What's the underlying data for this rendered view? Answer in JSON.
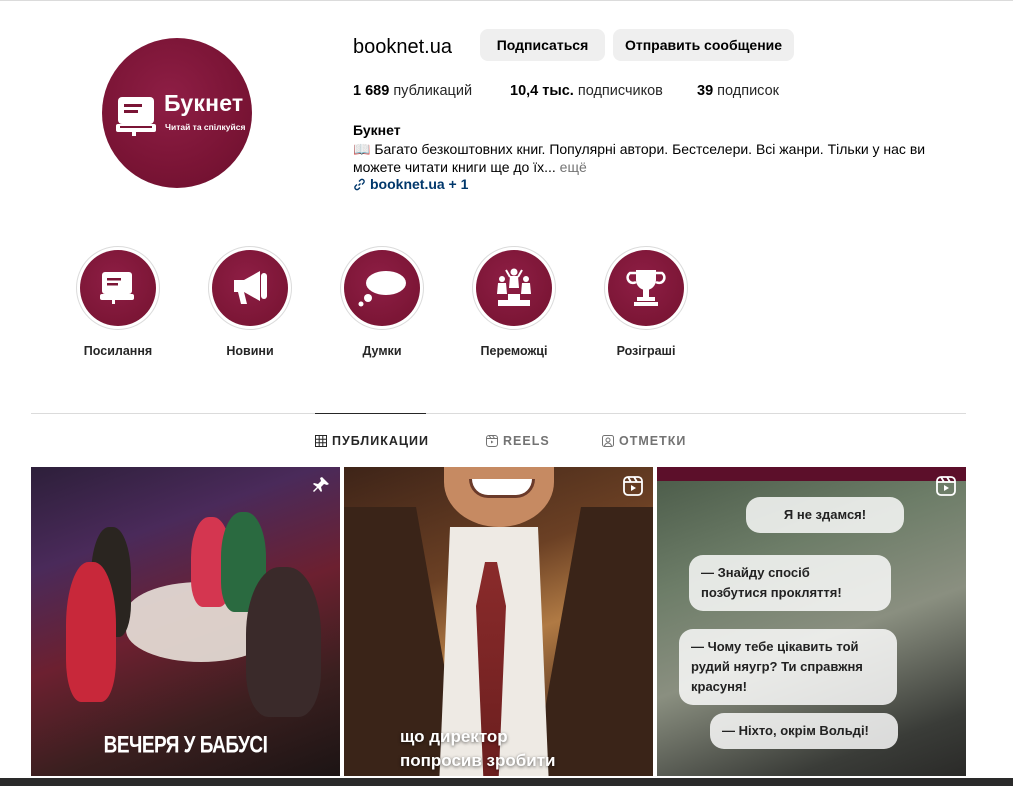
{
  "profile": {
    "username": "booknet.ua",
    "avatar_brand": "Букнет",
    "avatar_slogan": "Читай та спілкуйся",
    "follow_button": "Подписаться",
    "message_button": "Отправить сообщение",
    "stats": {
      "posts_count": "1 689",
      "posts_label": "публикаций",
      "followers_count": "10,4 тыс.",
      "followers_label": "подписчиков",
      "following_count": "39",
      "following_label": "подписок"
    },
    "full_name": "Букнет",
    "bio": "📖 Багато безкоштовних книг. Популярні автори. Бестселери. Всі жанри. Тільки у нас ви можете читати книги ще до їх...",
    "bio_more": "ещё",
    "link_text": "booknet.ua + 1"
  },
  "highlights": [
    {
      "label": "Посилання",
      "icon": "book-icon"
    },
    {
      "label": "Новини",
      "icon": "megaphone-icon"
    },
    {
      "label": "Думки",
      "icon": "thought-bubble-icon"
    },
    {
      "label": "Переможці",
      "icon": "podium-winners-icon"
    },
    {
      "label": "Розіграші",
      "icon": "trophy-icon"
    }
  ],
  "tabs": [
    {
      "label": "ПУБЛИКАЦИИ",
      "icon": "grid-icon",
      "active": true
    },
    {
      "label": "REELS",
      "icon": "reels-icon",
      "active": false
    },
    {
      "label": "ОТМЕТКИ",
      "icon": "tagged-icon",
      "active": false
    }
  ],
  "posts": [
    {
      "caption": "ВЕЧЕРЯ У БАБУСІ",
      "badge_icon": "pin-icon"
    },
    {
      "caption_line1": "що директор",
      "caption_line2": "попросив зробити",
      "badge_icon": "reels-icon"
    },
    {
      "bubbles": [
        "Я не здамся!",
        "— Знайду спосіб позбутися прокляття!",
        "— Чому тебе цікавить той рудий няугр? Ти справжня красуня!",
        "— Ніхто, окрім Вольді!"
      ],
      "badge_icon": "reels-icon"
    }
  ],
  "colors": {
    "brand": "#7a1435",
    "link": "#00376b",
    "button_bg": "#efefef",
    "muted": "#737373"
  }
}
